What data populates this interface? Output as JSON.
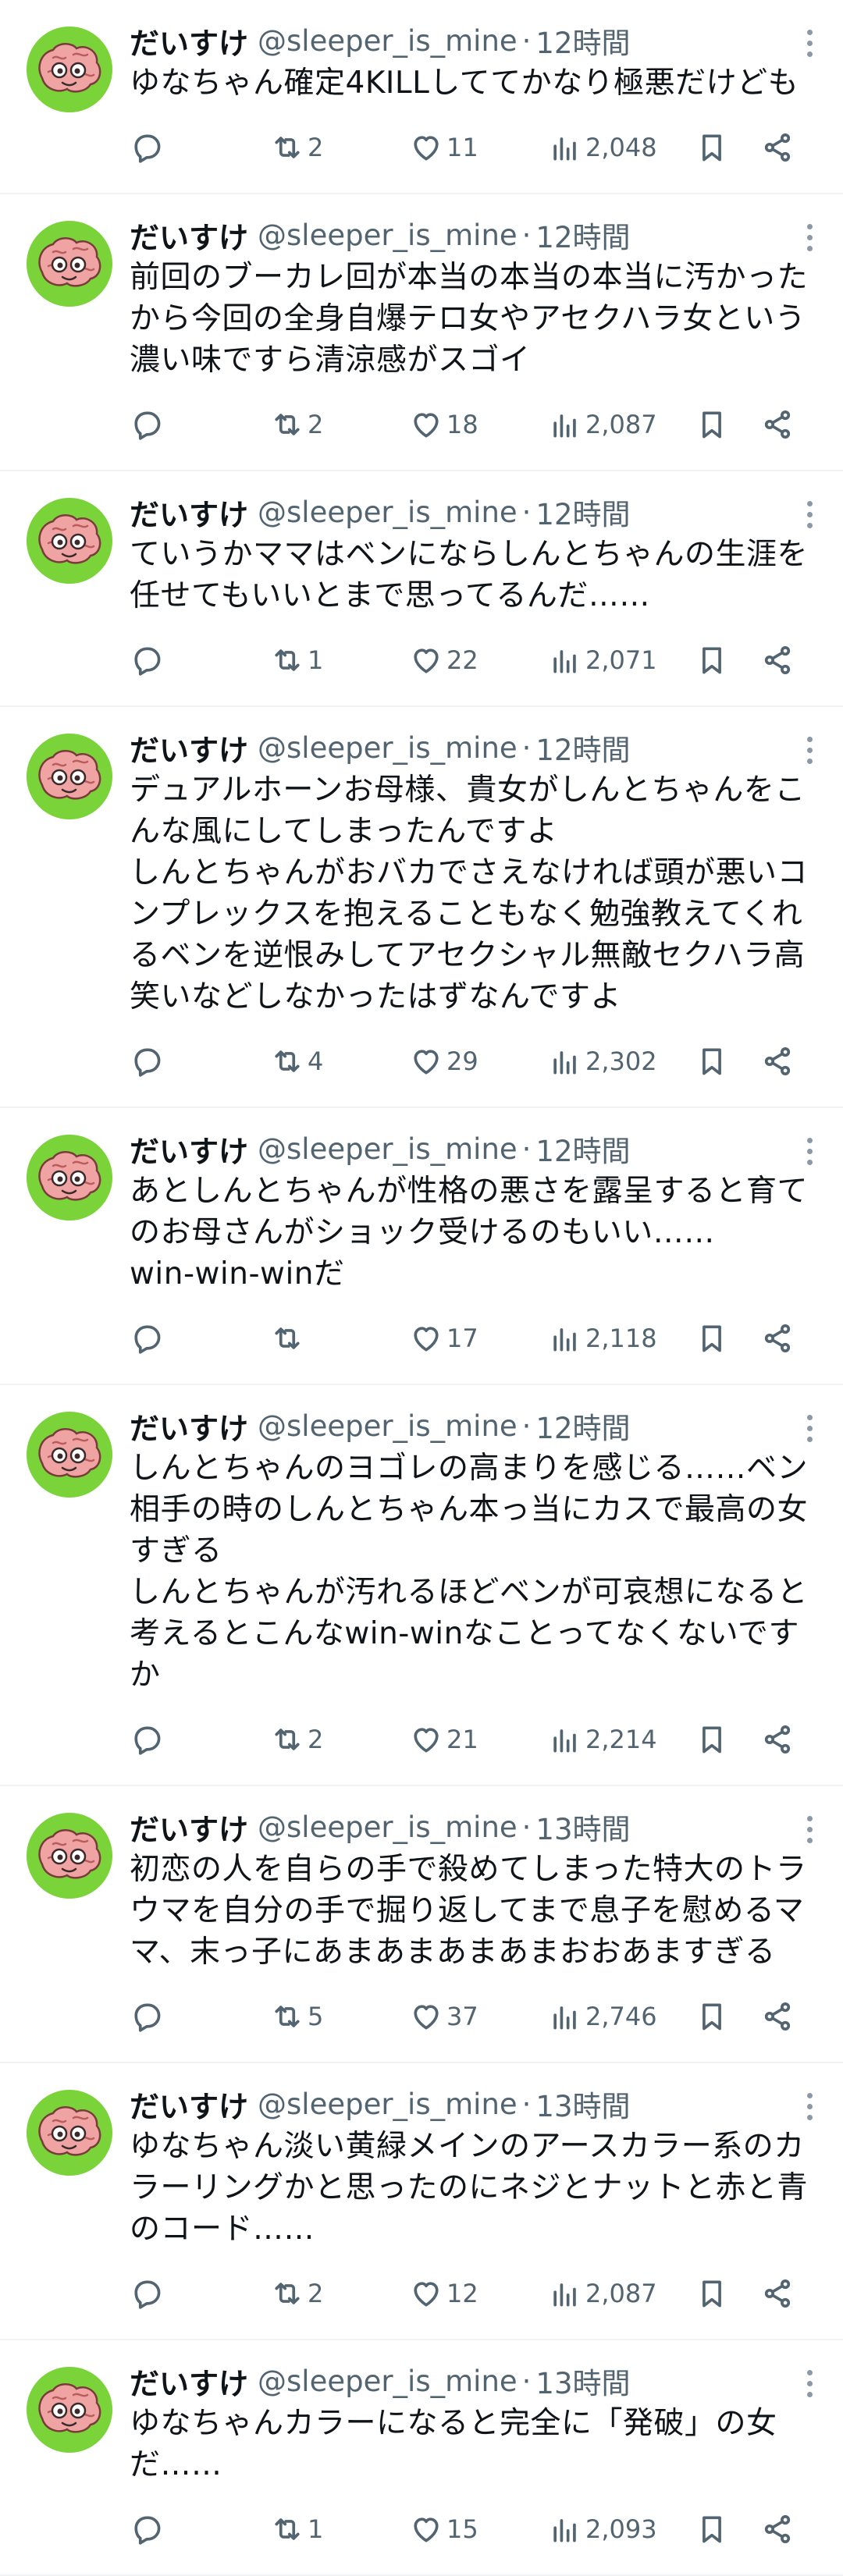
{
  "colors": {
    "text": "#0f1419",
    "secondary": "#536471",
    "divider": "#eff3f4",
    "avatar_bg": "#7bd33a"
  },
  "icons": {
    "reply": "speech-bubble-icon",
    "retweet": "retweet-arrows-icon",
    "like": "heart-icon",
    "views": "bar-chart-icon",
    "bookmark": "bookmark-icon",
    "share": "share-nodes-icon",
    "more": "vertical-ellipsis-icon"
  },
  "tweets": [
    {
      "name": "だいすけ",
      "handle": "@sleeper_is_mine",
      "sep": "·",
      "time": "12時間",
      "text": "ゆなちゃん確定4KILLしててかなり極悪だけども",
      "reposts": "2",
      "likes": "11",
      "views": "2,048"
    },
    {
      "name": "だいすけ",
      "handle": "@sleeper_is_mine",
      "sep": "·",
      "time": "12時間",
      "text": "前回のブーカレ回が本当の本当の本当に汚かったから今回の全身自爆テロ女やアセクハラ女という濃い味ですら清涼感がスゴイ",
      "reposts": "2",
      "likes": "18",
      "views": "2,087"
    },
    {
      "name": "だいすけ",
      "handle": "@sleeper_is_mine",
      "sep": "·",
      "time": "12時間",
      "text": "ていうかママはベンにならしんとちゃんの生涯を任せてもいいとまで思ってるんだ……",
      "reposts": "1",
      "likes": "22",
      "views": "2,071"
    },
    {
      "name": "だいすけ",
      "handle": "@sleeper_is_mine",
      "sep": "·",
      "time": "12時間",
      "text": "デュアルホーンお母様、貴女がしんとちゃんをこんな風にしてしまったんですよ\nしんとちゃんがおバカでさえなければ頭が悪いコンプレックスを抱えることもなく勉強教えてくれるベンを逆恨みしてアセクシャル無敵セクハラ高笑いなどしなかったはずなんですよ",
      "reposts": "4",
      "likes": "29",
      "views": "2,302"
    },
    {
      "name": "だいすけ",
      "handle": "@sleeper_is_mine",
      "sep": "·",
      "time": "12時間",
      "text": "あとしんとちゃんが性格の悪さを露呈すると育てのお母さんがショック受けるのもいい……\nwin-win-winだ",
      "reposts": "",
      "likes": "17",
      "views": "2,118"
    },
    {
      "name": "だいすけ",
      "handle": "@sleeper_is_mine",
      "sep": "·",
      "time": "12時間",
      "text": "しんとちゃんのヨゴレの高まりを感じる……ベン相手の時のしんとちゃん本っ当にカスで最高の女すぎる\nしんとちゃんが汚れるほどベンが可哀想になると考えるとこんなwin-winなことってなくないですか",
      "reposts": "2",
      "likes": "21",
      "views": "2,214"
    },
    {
      "name": "だいすけ",
      "handle": "@sleeper_is_mine",
      "sep": "·",
      "time": "13時間",
      "text": "初恋の人を自らの手で殺めてしまった特大のトラウマを自分の手で掘り返してまで息子を慰めるママ、末っ子にあまあまあまあまおおあますぎる",
      "reposts": "5",
      "likes": "37",
      "views": "2,746"
    },
    {
      "name": "だいすけ",
      "handle": "@sleeper_is_mine",
      "sep": "·",
      "time": "13時間",
      "text": "ゆなちゃん淡い黄緑メインのアースカラー系のカラーリングかと思ったのにネジとナットと赤と青のコード……",
      "reposts": "2",
      "likes": "12",
      "views": "2,087"
    },
    {
      "name": "だいすけ",
      "handle": "@sleeper_is_mine",
      "sep": "·",
      "time": "13時間",
      "text": "ゆなちゃんカラーになると完全に「発破」の女だ……",
      "reposts": "1",
      "likes": "15",
      "views": "2,093"
    }
  ]
}
